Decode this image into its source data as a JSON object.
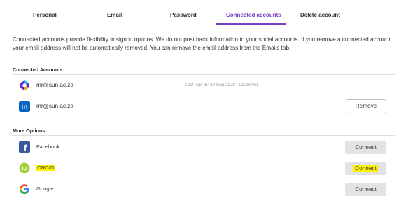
{
  "tabs": [
    {
      "label": "Personal"
    },
    {
      "label": "Email"
    },
    {
      "label": "Password"
    },
    {
      "label": "Connected accounts",
      "active": true
    },
    {
      "label": "Delete account"
    }
  ],
  "intro": "Connected accounts provide flexibility in sign in options. We do not post back information to your social accounts. If you remove a connected account, your email address will not be automatically removed. You can remove the email address from the Emails tab.",
  "connected": {
    "title": "Connected Accounts",
    "accounts": [
      {
        "icon": "sign-in-provider-logo-icon",
        "email": "mr@sun.ac.za",
        "meta": "Last sign in: 30 Sep 2022 | 03:38 PM"
      },
      {
        "icon": "linkedin-icon",
        "email": "mr@sun.ac.za",
        "action": "Remove"
      }
    ]
  },
  "more": {
    "title": "More Options",
    "options": [
      {
        "icon": "facebook-icon",
        "name": "Facebook",
        "action": "Connect"
      },
      {
        "icon": "orcid-icon",
        "name": "ORCID",
        "action": "Connect",
        "highlighted": true
      },
      {
        "icon": "google-icon",
        "name": "Google",
        "action": "Connect"
      }
    ]
  },
  "colors": {
    "accent": "#7b3fc7",
    "highlight": "#fff200",
    "linkedin": "#0a66c2",
    "facebook": "#3b5998",
    "orcid": "#a6ce39"
  }
}
